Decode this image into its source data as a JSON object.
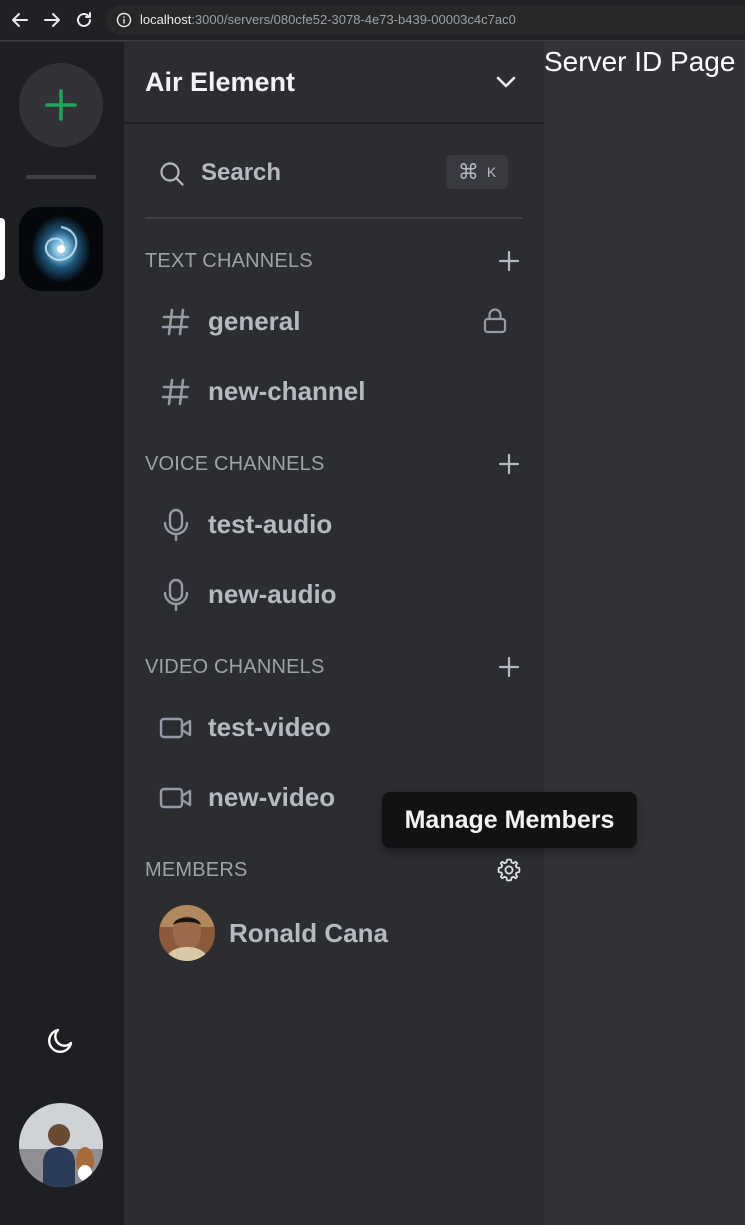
{
  "browser": {
    "url_host": "localhost",
    "url_path": ":3000/servers/080cfe52-3078-4e73-b439-00003c4c7ac0",
    "icons": [
      "back-icon",
      "forward-icon",
      "reload-icon",
      "info-icon"
    ]
  },
  "server_rail": {
    "add_server_icon": "plus-icon",
    "theme_icon": "moon-icon"
  },
  "sidebar": {
    "server_name": "Air Element",
    "search_label": "Search",
    "search_shortcut_cmd": "⌘",
    "search_shortcut_key": "K",
    "sections": {
      "text": {
        "title": "TEXT CHANNELS",
        "channels": [
          {
            "name": "general",
            "icon": "hash-icon",
            "locked": true
          },
          {
            "name": "new-channel",
            "icon": "hash-icon"
          }
        ]
      },
      "voice": {
        "title": "VOICE CHANNELS",
        "channels": [
          {
            "name": "test-audio",
            "icon": "microphone-icon"
          },
          {
            "name": "new-audio",
            "icon": "microphone-icon"
          }
        ]
      },
      "video": {
        "title": "VIDEO CHANNELS",
        "channels": [
          {
            "name": "test-video",
            "icon": "video-camera-icon"
          },
          {
            "name": "new-video",
            "icon": "video-camera-icon"
          }
        ]
      },
      "members": {
        "title": "MEMBERS",
        "members": [
          {
            "name": "Ronald Cana"
          }
        ]
      }
    }
  },
  "main": {
    "title": "Server ID Page"
  },
  "tooltip": {
    "text": "Manage Members"
  },
  "colors": {
    "accent_green": "#23a559",
    "sidebar_bg": "#2b2d31",
    "rail_bg": "#1e1f22",
    "main_bg": "#313338"
  }
}
